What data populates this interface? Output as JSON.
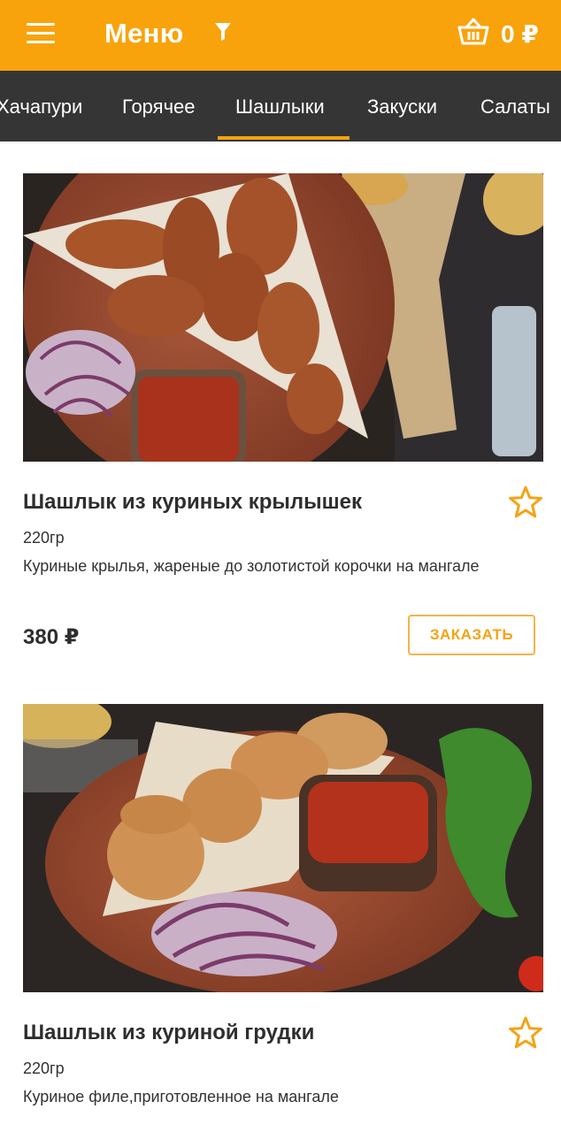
{
  "header": {
    "title": "Меню",
    "cart_total": "0 ₽",
    "brand_color": "#f8a30c",
    "icons": [
      "hamburger-icon",
      "filter-icon",
      "basket-icon"
    ]
  },
  "tabs": {
    "items": [
      {
        "label": "Хачапури"
      },
      {
        "label": "Горячее"
      },
      {
        "label": "Шашлыки"
      },
      {
        "label": "Закуски"
      },
      {
        "label": "Салаты"
      }
    ],
    "active": "Шашлыки"
  },
  "products": [
    {
      "title": "Шашлык из куриных крылышек",
      "weight": "220гр",
      "description": "Куриные крылья, жареные до золотистой корочки на мангале",
      "price": "380 ₽",
      "order_label": "ЗАКАЗАТЬ",
      "favorite": false
    },
    {
      "title": "Шашлык из куриной грудки",
      "weight": "220гр",
      "description": "Куриное филе,приготовленное на мангале",
      "favorite": false
    }
  ]
}
